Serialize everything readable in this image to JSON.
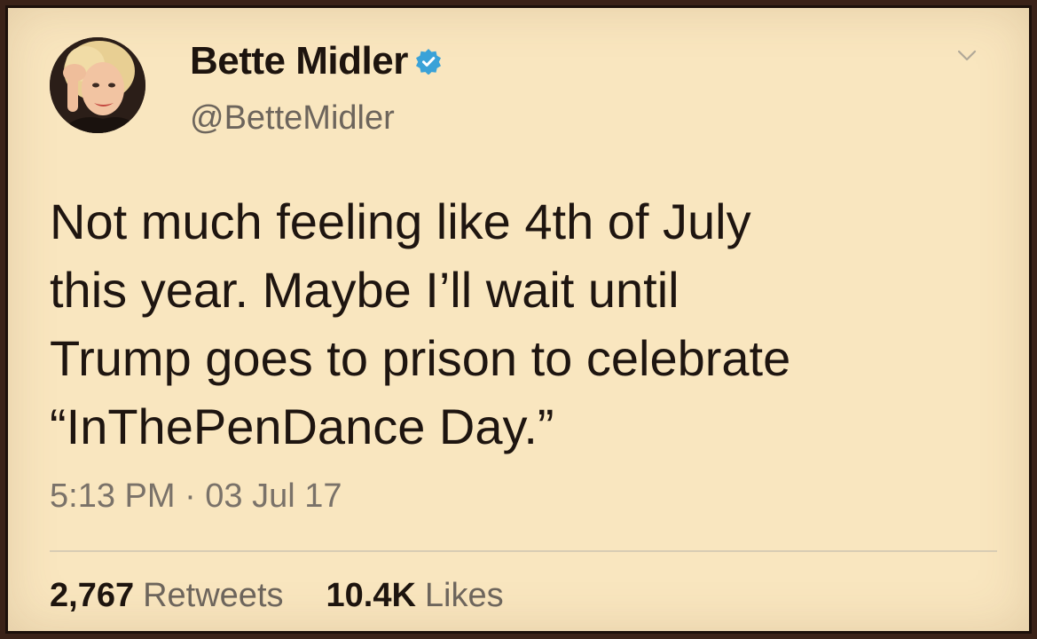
{
  "tweet": {
    "author": {
      "display_name": "Bette Midler",
      "handle": "@BetteMidler",
      "verified": true,
      "avatar_icon": "profile-photo"
    },
    "text": "Not much feeling like 4th of July\nthis year. Maybe I’ll wait until\nTrump goes to prison to celebrate\n“InThePenDance Day.”",
    "timestamp": "5:13 PM · 03 Jul 17",
    "stats": {
      "retweets_count": "2,767",
      "retweets_label": "Retweets",
      "likes_count": "10.4K",
      "likes_label": "Likes"
    },
    "menu_icon": "chevron-down-icon"
  },
  "colors": {
    "background": "#f9e6bf",
    "verified_badge": "#3aa2d8",
    "frame": "#3a2218"
  }
}
